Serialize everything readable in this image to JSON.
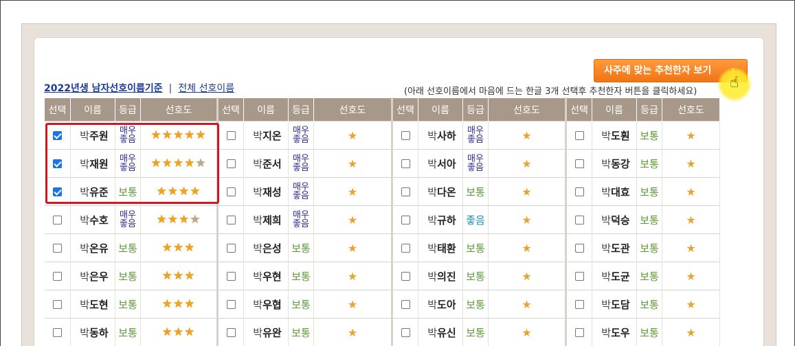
{
  "recommend_button": {
    "label": "사주에 맞는 추천한자 보기",
    "chevron": "›"
  },
  "links": {
    "primary": "2022년생 남자선호이름기준",
    "separator": "|",
    "secondary": "전체 선호이름"
  },
  "hint": "(아래 선호이름에서 마음에 드는 한글 3개 선택후 추천한자 버튼을 클릭하세요)",
  "headers": [
    "선택",
    "이름",
    "등급",
    "선호도"
  ],
  "grade_labels": {
    "great": "매우 좋음",
    "great_top": "매우",
    "great_bottom": "좋음",
    "normal": "보통",
    "good": "좋음"
  },
  "surname": "박",
  "star_glyph": "★",
  "colors": {
    "header_bg": "#a89889",
    "accent": "#f07414",
    "highlight": "#d01822",
    "great": "#2a2a9a",
    "normal": "#5a9a32",
    "good": "#1e8fb8"
  },
  "columns": [
    {
      "rows": [
        {
          "given": "주원",
          "grade": "great",
          "stars": 5,
          "checked": true
        },
        {
          "given": "재원",
          "grade": "great",
          "stars": 4.5,
          "checked": true
        },
        {
          "given": "유준",
          "grade": "normal",
          "stars": 4,
          "checked": true
        },
        {
          "given": "수호",
          "grade": "great",
          "stars": 3.5,
          "checked": false
        },
        {
          "given": "온유",
          "grade": "normal",
          "stars": 3,
          "checked": false
        },
        {
          "given": "은우",
          "grade": "normal",
          "stars": 3,
          "checked": false
        },
        {
          "given": "도현",
          "grade": "normal",
          "stars": 3,
          "checked": false
        },
        {
          "given": "동하",
          "grade": "normal",
          "stars": 3,
          "checked": false
        }
      ]
    },
    {
      "rows": [
        {
          "given": "지온",
          "grade": "great",
          "stars": 1,
          "checked": false
        },
        {
          "given": "준서",
          "grade": "great",
          "stars": 1,
          "checked": false
        },
        {
          "given": "재성",
          "grade": "great",
          "stars": 1,
          "checked": false
        },
        {
          "given": "제희",
          "grade": "great",
          "stars": 1,
          "checked": false
        },
        {
          "given": "은성",
          "grade": "normal",
          "stars": 1,
          "checked": false
        },
        {
          "given": "우현",
          "grade": "normal",
          "stars": 1,
          "checked": false
        },
        {
          "given": "우협",
          "grade": "normal",
          "stars": 1,
          "checked": false
        },
        {
          "given": "유완",
          "grade": "normal",
          "stars": 1,
          "checked": false
        }
      ]
    },
    {
      "rows": [
        {
          "given": "사하",
          "grade": "great",
          "stars": 1,
          "checked": false
        },
        {
          "given": "서아",
          "grade": "great",
          "stars": 1,
          "checked": false
        },
        {
          "given": "다온",
          "grade": "normal",
          "stars": 1,
          "checked": false
        },
        {
          "given": "규하",
          "grade": "good",
          "stars": 1,
          "checked": false
        },
        {
          "given": "태환",
          "grade": "normal",
          "stars": 1,
          "checked": false
        },
        {
          "given": "의진",
          "grade": "normal",
          "stars": 1,
          "checked": false
        },
        {
          "given": "도아",
          "grade": "normal",
          "stars": 1,
          "checked": false
        },
        {
          "given": "유신",
          "grade": "normal",
          "stars": 1,
          "checked": false
        }
      ]
    },
    {
      "rows": [
        {
          "given": "도훤",
          "grade": "normal",
          "stars": 1,
          "checked": false
        },
        {
          "given": "동강",
          "grade": "normal",
          "stars": 1,
          "checked": false
        },
        {
          "given": "대효",
          "grade": "normal",
          "stars": 1,
          "checked": false
        },
        {
          "given": "덕승",
          "grade": "normal",
          "stars": 1,
          "checked": false
        },
        {
          "given": "도관",
          "grade": "normal",
          "stars": 1,
          "checked": false
        },
        {
          "given": "도균",
          "grade": "normal",
          "stars": 1,
          "checked": false
        },
        {
          "given": "도담",
          "grade": "normal",
          "stars": 1,
          "checked": false
        },
        {
          "given": "도우",
          "grade": "normal",
          "stars": 1,
          "checked": false
        }
      ]
    }
  ]
}
